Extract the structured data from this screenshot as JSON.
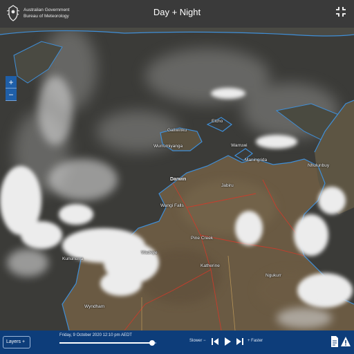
{
  "header": {
    "agency_line1": "Australian Government",
    "agency_line2": "Bureau of Meteorology",
    "title": "Day + Night"
  },
  "map": {
    "zoom_in": "+",
    "zoom_out": "−",
    "places": {
      "galiwinku": "Galiwinku",
      "wurrumiyanga": "Wurrumiyanga",
      "darwin": "Darwin",
      "jabiru": "Jabiru",
      "nhulunbuy": "Nhulunbuy",
      "kununurra": "Kununurra",
      "katherine": "Katherine",
      "wyndham": "Wyndham",
      "maningrida": "Maningrida",
      "warruwi": "Warruwi",
      "wadeye": "Wadeye",
      "pine_creek": "Pine Creek",
      "wangi_falls": "Wangi Falls",
      "elcho": "Elcho",
      "ngukurr": "Ngukurr"
    }
  },
  "bottom_bar": {
    "layers_label": "Layers +",
    "datetime": "Friday, 9 October 2020 12:10 pm AEDT",
    "slower_label": "Slower −",
    "faster_label": "+ Faster",
    "progress": 0.96
  },
  "colors": {
    "header_bg": "#3a3a3a",
    "bottom_bar_bg": "#0d3d7a",
    "zoom_bg": "#1f5fa8",
    "coastline": "#3f8fd8",
    "roads": "#d23a2a"
  }
}
